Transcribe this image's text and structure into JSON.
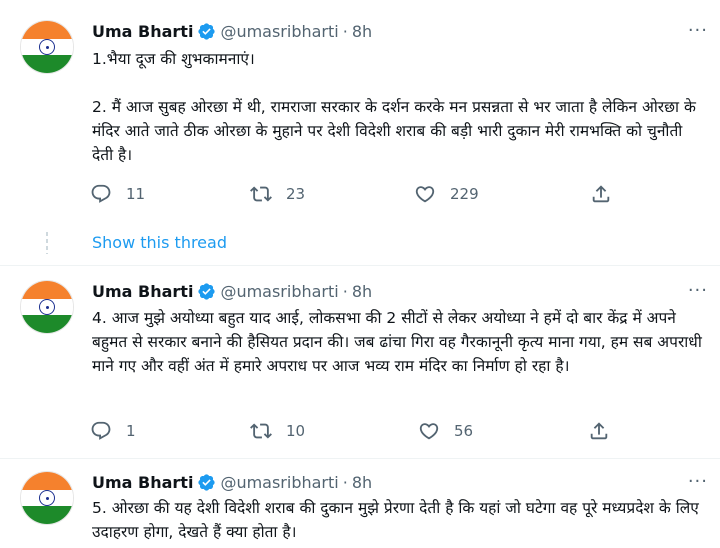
{
  "tweets": [
    {
      "name": "Uma Bharti",
      "handle": "@umasribharti",
      "dot": "·",
      "time": "8h",
      "text": "1.भैया दूज की शुभकामनाएं।\n\n2. मैं आज सुबह ओरछा में थी, रामराजा सरकार के दर्शन करके मन प्रसन्नता से भर जाता है लेकिन ओरछा के मंदिर आते जाते ठीक ओरछा के मुहाने पर देशी विदेशी शराब की बड़ी भारी दुकान मेरी रामभक्ति को चुनौती देती है।",
      "replies": "11",
      "retweets": "23",
      "likes": "229"
    },
    {
      "name": "Uma Bharti",
      "handle": "@umasribharti",
      "dot": "·",
      "time": "8h",
      "text": "4. आज मुझे अयोध्या बहुत याद आई, लोकसभा की 2 सीटों से लेकर अयोध्या ने हमें दो बार केंद्र में अपने बहुमत से सरकार बनाने की हैसियत प्रदान की। जब ढांचा गिरा वह गैरकानूनी कृत्य माना गया, हम सब अपराधी माने गए और वहीं अंत में हमारे अपराध पर आज भव्य राम मंदिर का निर्माण हो रहा है।",
      "replies": "1",
      "retweets": "10",
      "likes": "56"
    },
    {
      "name": "Uma Bharti",
      "handle": "@umasribharti",
      "dot": "·",
      "time": "8h",
      "text": "5. ओरछा की यह देशी विदेशी शराब की दुकान मुझे प्रेरणा देती है कि यहां जो घटेगा वह पूरे मध्यप्रदेश के लिए उदाहरण होगा, देखते हैं क्या होता है।"
    }
  ],
  "show_thread": "Show this thread",
  "more_glyph": "···",
  "colors": {
    "text": "#0f1419",
    "secondary": "#536471",
    "accent": "#1d9bf0",
    "divider": "#eff3f4",
    "thread_line": "#cfd9de"
  },
  "icons": [
    "verified-badge-icon",
    "reply-icon",
    "retweet-icon",
    "like-icon",
    "share-icon",
    "more-options-icon"
  ]
}
